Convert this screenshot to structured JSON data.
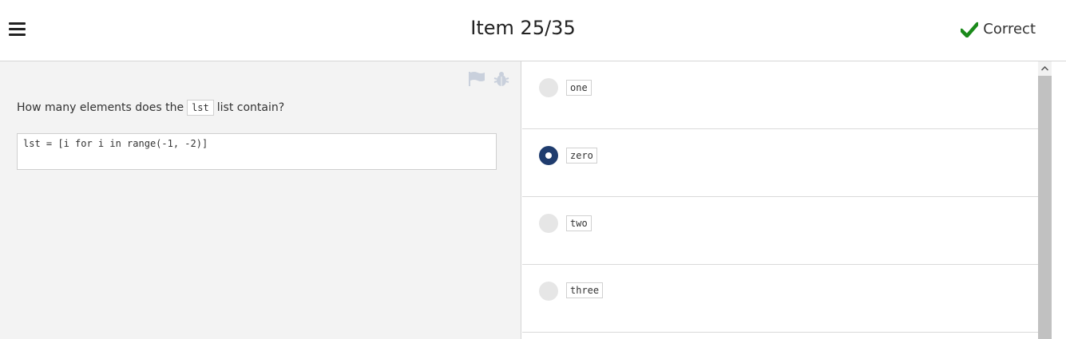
{
  "header": {
    "title": "Item 25/35",
    "status_label": "Correct",
    "status_color": "#1a8a1a",
    "menu_icon": "hamburger-menu-icon",
    "status_icon": "checkmark-icon"
  },
  "question": {
    "prefix": "How many elements does the",
    "inline_code": "lst",
    "suffix": "list contain?",
    "code": "lst = [i for i in range(-1, -2)]",
    "tools": [
      "flag-icon",
      "bug-icon"
    ]
  },
  "options": [
    {
      "label": "one",
      "selected": false
    },
    {
      "label": "zero",
      "selected": true
    },
    {
      "label": "two",
      "selected": false
    },
    {
      "label": "three",
      "selected": false
    }
  ],
  "colors": {
    "selected_radio": "#1f3c6e",
    "left_pane_bg": "#f3f3f3"
  }
}
